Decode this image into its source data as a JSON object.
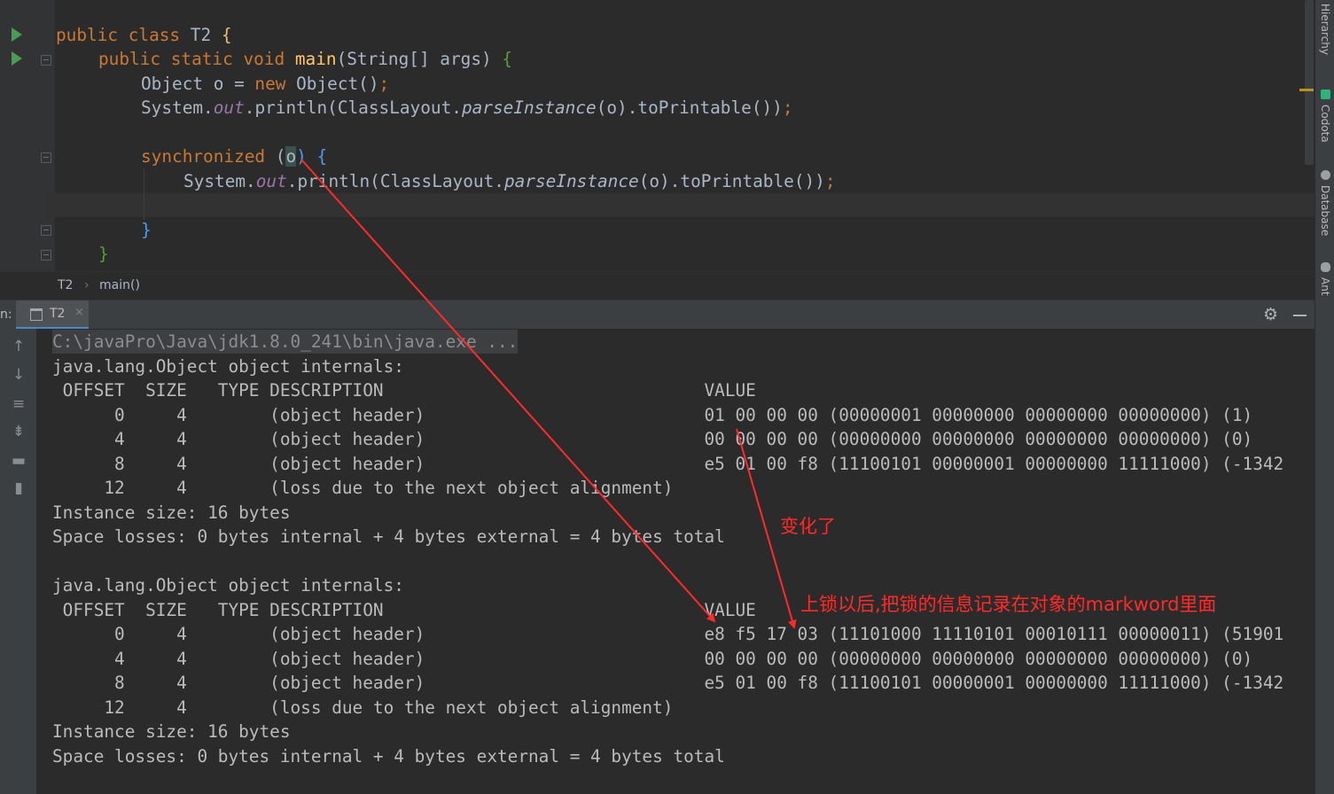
{
  "editor": {
    "lines": {
      "class_decl": {
        "kw1": "public",
        "kw2": "class",
        "name": "T2",
        "brace": "{"
      },
      "main_decl": {
        "kw1": "public",
        "kw2": "static",
        "kw3": "void",
        "fn": "main",
        "params_open": "(String[] args)",
        "brace": "{"
      },
      "obj_decl": {
        "pre": "Object o = ",
        "kw": "new",
        "post": " Object()",
        "semi": ";"
      },
      "println1": {
        "a": "System.",
        "out": "out",
        "b": ".println(ClassLayout.",
        "parse": "parseInstance",
        "c": "(o).toPrintable())",
        "semi": ";"
      },
      "sync": {
        "kw": "synchronized",
        "open": " (",
        "o": "o",
        "close": ") {"
      },
      "println2": {
        "a": "System.",
        "out": "out",
        "b": ".println(ClassLayout.",
        "parse": "parseInstance",
        "c": "(o).toPrintable())",
        "semi": ";"
      },
      "close_sync": "}",
      "close_main": "}"
    }
  },
  "breadcrumb": {
    "class": "T2",
    "sep": "›",
    "method": "main()"
  },
  "run_window": {
    "prefix": "n:",
    "tab_label": "T2",
    "tab_close": "×"
  },
  "console": {
    "lines": [
      "C:\\javaPro\\Java\\jdk1.8.0_241\\bin\\java.exe ...",
      "java.lang.Object object internals:",
      " OFFSET  SIZE   TYPE DESCRIPTION                               VALUE",
      "      0     4        (object header)                           01 00 00 00 (00000001 00000000 00000000 00000000) (1)",
      "      4     4        (object header)                           00 00 00 00 (00000000 00000000 00000000 00000000) (0)",
      "      8     4        (object header)                           e5 01 00 f8 (11100101 00000001 00000000 11111000) (-1342",
      "     12     4        (loss due to the next object alignment)",
      "Instance size: 16 bytes",
      "Space losses: 0 bytes internal + 4 bytes external = 4 bytes total",
      "",
      "java.lang.Object object internals:",
      " OFFSET  SIZE   TYPE DESCRIPTION                               VALUE",
      "      0     4        (object header)                           e8 f5 17 03 (11101000 11110101 00010111 00000011) (51901",
      "      4     4        (object header)                           00 00 00 00 (00000000 00000000 00000000 00000000) (0)",
      "      8     4        (object header)                           e5 01 00 f8 (11100101 00000001 00000000 11111000) (-1342",
      "     12     4        (loss due to the next object alignment)",
      "Instance size: 16 bytes",
      "Space losses: 0 bytes internal + 4 bytes external = 4 bytes total"
    ]
  },
  "right_stripe": {
    "hierarchy": "Hierarchy",
    "codota": "Codota",
    "database": "Database",
    "ant": "Ant"
  },
  "annotations": {
    "changed": "变化了",
    "after_lock": "上锁以后,把锁的信息记录在对象的markword里面"
  },
  "colors": {
    "annotation": "#ff2a2a",
    "keyword": "#cc7832",
    "method": "#ffc66d",
    "static_field": "#9876aa",
    "run_green": "#499c54"
  }
}
